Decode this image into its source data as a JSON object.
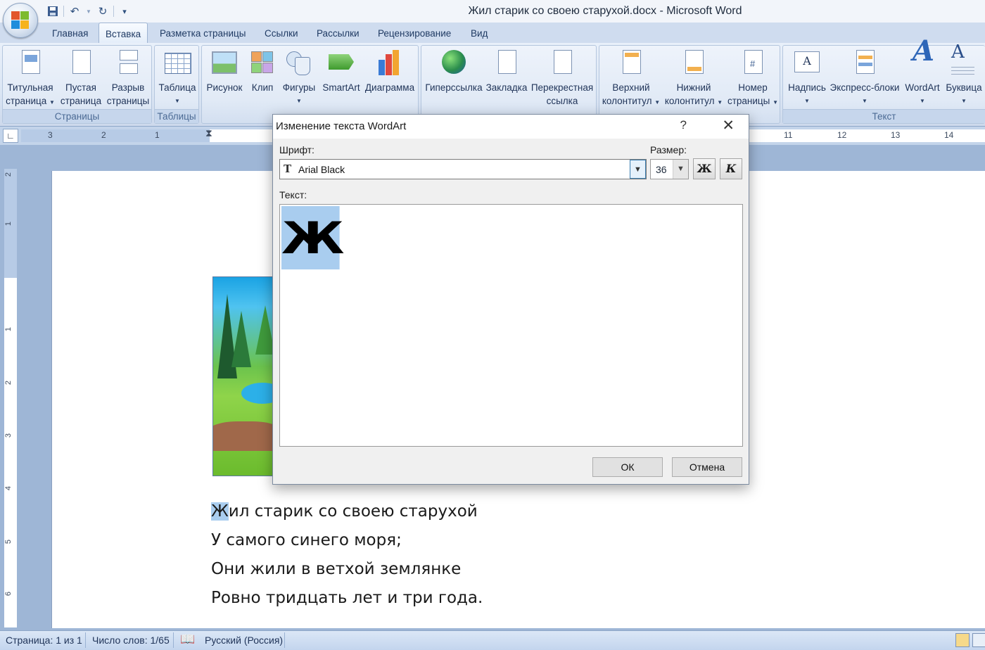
{
  "window": {
    "title": "Жил старик со своею старухой.docx - Microsoft Word"
  },
  "qat": {
    "icons": [
      "save-icon",
      "undo-icon",
      "redo-icon",
      "customize-icon"
    ]
  },
  "tabs": [
    "Главная",
    "Вставка",
    "Разметка страницы",
    "Ссылки",
    "Рассылки",
    "Рецензирование",
    "Вид"
  ],
  "active_tab": "Вставка",
  "ribbon": {
    "pages": {
      "label": "Страницы",
      "buttons": [
        {
          "line1": "Титульная",
          "line2": "страница"
        },
        {
          "line1": "Пустая",
          "line2": "страница"
        },
        {
          "line1": "Разрыв",
          "line2": "страницы"
        }
      ]
    },
    "tables": {
      "label": "Таблицы",
      "button": "Таблица"
    },
    "illustrations": {
      "buttons": [
        "Рисунок",
        "Клип",
        "Фигуры",
        "SmartArt",
        "Диаграмма"
      ]
    },
    "links": {
      "buttons": [
        {
          "line1": "Гиперссылка",
          "line2": ""
        },
        {
          "line1": "Закладка",
          "line2": ""
        },
        {
          "line1": "Перекрестная",
          "line2": "ссылка"
        }
      ]
    },
    "headers": {
      "buttons": [
        {
          "line1": "Верхний",
          "line2": "колонтитул"
        },
        {
          "line1": "Нижний",
          "line2": "колонтитул"
        },
        {
          "line1": "Номер",
          "line2": "страницы"
        }
      ]
    },
    "text": {
      "label": "Текст",
      "buttons": [
        "Надпись",
        "Экспресс-блоки",
        "WordArt",
        "Буквица"
      ]
    }
  },
  "ruler": {
    "left_marks": [
      "3",
      "2",
      "1"
    ],
    "right_marks": [
      "11",
      "12",
      "13",
      "14"
    ],
    "vertical_marks": [
      "2",
      "1",
      "1",
      "2",
      "3",
      "4",
      "5",
      "6"
    ]
  },
  "document": {
    "first_letter": "Ж",
    "first_line_rest": "ил старик со своею старухой",
    "lines": [
      "У самого синего моря;",
      "Они жили в ветхой землянке",
      "Ровно тридцать лет и три года."
    ]
  },
  "dialog": {
    "title": "Изменение текста WordArt",
    "help": "?",
    "close": "✕",
    "font_label": "Шрифт:",
    "font_value": "Arial Black",
    "size_label": "Размер:",
    "size_value": "36",
    "bold_label": "Ж",
    "italic_label": "К",
    "text_label": "Текст:",
    "text_value": "Ж",
    "ok": "ОК",
    "cancel": "Отмена"
  },
  "status": {
    "page": "Страница: 1 из 1",
    "words": "Число слов: 1/65",
    "language": "Русский (Россия)"
  }
}
